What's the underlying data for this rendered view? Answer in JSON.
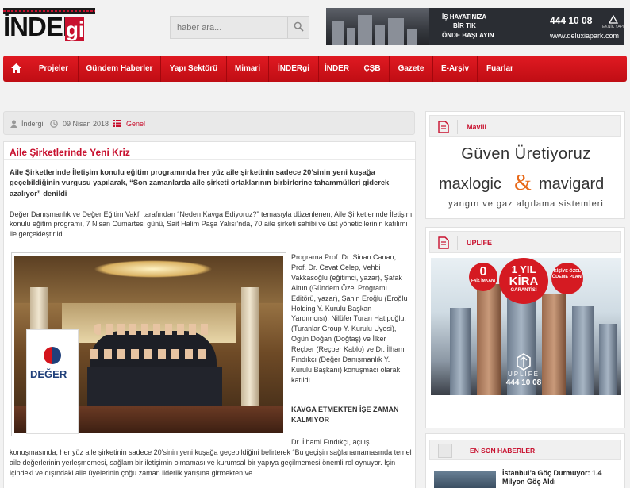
{
  "logo": {
    "main": "İNDER",
    "accent": "gi"
  },
  "search": {
    "placeholder": "haber ara..."
  },
  "banner": {
    "line1": "İŞ HAYATINIZA",
    "line2": "BİR TIK",
    "line3": "ÖNDE BAŞLAYIN",
    "phone": "444 10 08",
    "url": "www.deluxiapark.com",
    "brand": "TEKNİK YAPI"
  },
  "nav": {
    "items": [
      "Projeler",
      "Gündem Haberler",
      "Yapı Sektörü",
      "Mimari",
      "İNDERgi",
      "İNDER",
      "ÇŞB",
      "Gazete",
      "E-Arşiv",
      "Fuarlar"
    ]
  },
  "meta": {
    "author": "İndergi",
    "date": "09 Nisan 2018",
    "category": "Genel"
  },
  "article": {
    "title": "Aile Şirketlerinde Yeni Kriz",
    "lead": "Aile Şirketlerinde İletişim konulu eğitim programında her yüz aile şirketinin sadece 20’sinin yeni kuşağa geçebildiğinin vurgusu yapılarak, “Son zamanlarda aile şirketi ortaklarının birbirlerine tahammülleri giderek azalıyor” denildi",
    "intro": "Değer Danışmanlık ve Değer Eğitim Vakfı tarafından “Neden Kavga Ediyoruz?” temasıyla düzenlenen, Aile Şirketlerinde İletişim konulu eğitim programı, 7 Nisan Cumartesi günü, Sait Halim Paşa Yalısı’nda, 70 aile şirketi sahibi ve üst yöneticilerinin katılımı ile gerçekleştirildi.",
    "caption": "Programa Prof. Dr. Sinan Canan, Prof. Dr. Cevat Celep, Vehbi Vakkasoğlu (eğitimci, yazar), Şafak Altun (Gündem Özel Programı Editörü, yazar), Şahin Eroğlu (Eroğlu Holding Y. Kurulu Başkan Yardımcısı), Nilüfer Turan Hatipoğlu, (Turanlar Group Y. Kurulu Üyesi), Ogün Doğan (Doğtaş) ve İlker Reçber (Reçber Kablo) ve Dr. İlhami Fındıkçı (Değer Danışmanlık Y. Kurulu Başkanı) konuşmacı olarak katıldı.",
    "subhead": "KAVGA ETMEKTEN İŞE ZAMAN KALMIYOR",
    "body_start": "Dr. İlhami Fındıkçı, açılış",
    "body": "konuşmasında, her yüz aile şirketinin sadece 20’sinin yeni kuşağa geçebildiğini belirterek “Bu geçişin sağlanamamasında temel aile değerlerinin yerleşmemesi, sağlam bir iletişimin olmaması ve kurumsal bir yapıya geçilmemesi önemli rol oynuyor. İşin içindeki ve dışındaki aile üyelerinin çoğu zaman liderlik yarışına girmekten ve",
    "photo_banner": "DEĞER"
  },
  "sidebar": {
    "mavili": {
      "title": "Mavili",
      "ad_line1": "Güven Üretiyoruz",
      "ad_brand1": "maxlogic",
      "ad_amp": "&",
      "ad_brand2": "mavigard",
      "ad_line3": "yangın ve gaz algılama sistemleri"
    },
    "uplife": {
      "title": "UPLIFE",
      "zero": "0",
      "zero_sub": "FAİZ İMKANI",
      "year": "1 YIL",
      "kira": "KİRA",
      "garanti": "GARANTİSİ",
      "ozel": "KİŞİYE ÖZEL ÖDEME PLANI",
      "brand": "UPLIFE",
      "phone": "444 10 08"
    },
    "news": {
      "title": "EN SON HABERLER",
      "items": [
        {
          "title": "İstanbul’a Göç Durmuyor: 1.4 Milyon Göç Aldı"
        }
      ]
    }
  },
  "colors": {
    "accent": "#c8102e",
    "nav": "#d7141c",
    "background": "#f2f2f2"
  }
}
